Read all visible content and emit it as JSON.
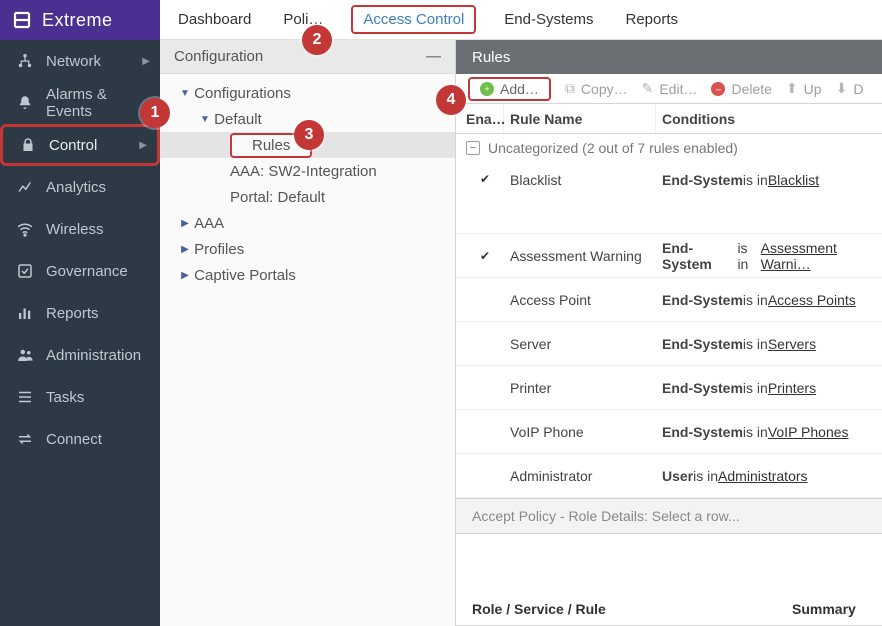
{
  "brand": {
    "label": "Extreme"
  },
  "topnav": {
    "dashboard": "Dashboard",
    "policy": "Poli…",
    "access_control": "Access Control",
    "end_systems": "End-Systems",
    "reports": "Reports"
  },
  "sidebar": {
    "network": "Network",
    "alarms": "Alarms & Events",
    "control": "Control",
    "analytics": "Analytics",
    "wireless": "Wireless",
    "governance": "Governance",
    "reports": "Reports",
    "administration": "Administration",
    "tasks": "Tasks",
    "connect": "Connect"
  },
  "config": {
    "title": "Configuration",
    "tree": {
      "configurations": "Configurations",
      "default": "Default",
      "rules": "Rules",
      "aaa_sw2": "AAA: SW2-Integration",
      "portal_default": "Portal: Default",
      "aaa": "AAA",
      "profiles": "Profiles",
      "captive_portals": "Captive Portals"
    }
  },
  "rules": {
    "title": "Rules",
    "toolbar": {
      "add": "Add…",
      "copy": "Copy…",
      "edit": "Edit…",
      "delete": "Delete",
      "up": "Up",
      "down": "D"
    },
    "columns": {
      "ena": "Ena…",
      "name": "Rule Name",
      "cond": "Conditions"
    },
    "group": "Uncategorized (2 out of 7 rules enabled)",
    "rows": [
      {
        "enabled": true,
        "name": "Blacklist",
        "subject": "End-System",
        "verb": " is in ",
        "link": "Blacklist"
      },
      {
        "enabled": true,
        "name": "Assessment Warning",
        "subject": "End-System",
        "verb": " is in ",
        "link": "Assessment Warni…"
      },
      {
        "enabled": false,
        "name": "Access Point",
        "subject": "End-System",
        "verb": " is in ",
        "link": "Access Points"
      },
      {
        "enabled": false,
        "name": "Server",
        "subject": "End-System",
        "verb": " is in ",
        "link": "Servers"
      },
      {
        "enabled": false,
        "name": "Printer",
        "subject": "End-System",
        "verb": " is in ",
        "link": "Printers"
      },
      {
        "enabled": false,
        "name": "VoIP Phone",
        "subject": "End-System",
        "verb": " is in ",
        "link": "VoIP Phones"
      },
      {
        "enabled": false,
        "name": "Administrator",
        "subject": "User",
        "verb": " is in ",
        "link": "Administrators"
      }
    ],
    "detail_placeholder": "Accept Policy - Role Details: Select a row...",
    "bottom": {
      "col1": "Role / Service / Rule",
      "col2": "Summary"
    }
  },
  "markers": {
    "m1": "1",
    "m2": "2",
    "m3": "3",
    "m4": "4"
  }
}
